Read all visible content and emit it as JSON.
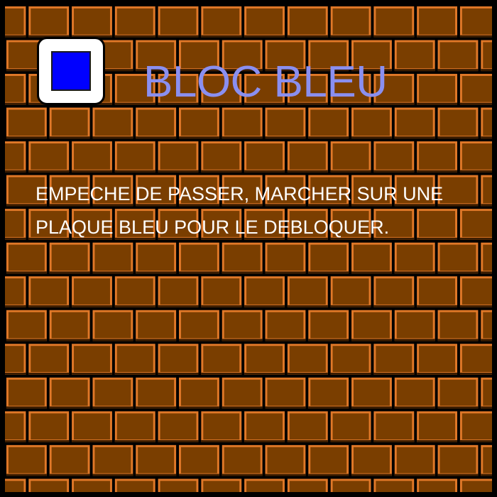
{
  "card": {
    "title": "BLOC BLEU",
    "description_lines": [
      "EMPECHE DE PASSER, MARCHER SUR UNE",
      "PLAQUE BLEU POUR LE DEBLOQUER."
    ]
  },
  "icon": {
    "name": "blue-block-icon",
    "fill_color": "#0000ff",
    "frame_color": "#ffffff"
  },
  "colors": {
    "title": "#8a8ff0",
    "text": "#ffffff",
    "brick": "#7a3e00",
    "brick_highlight": "#e07828",
    "mortar": "#000000",
    "border": "#000000"
  }
}
